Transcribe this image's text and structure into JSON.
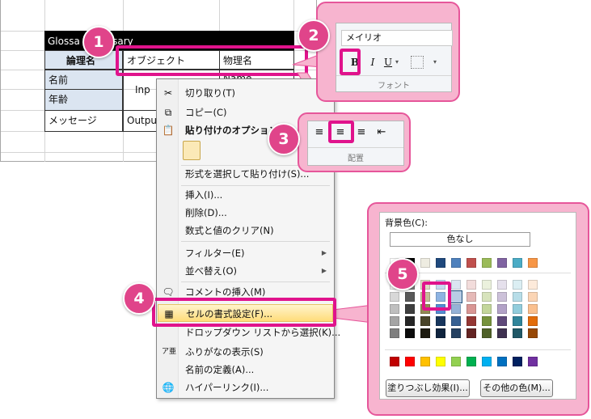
{
  "sheet": {
    "title_part1": "Glossa",
    "title_part2": "ssary",
    "col1_header": "論理名",
    "col2_header": "オブジェクト",
    "col3_header": "物理名",
    "row1": "名前",
    "row2": "年齢",
    "row3": "メッセージ",
    "inp": "Inp",
    "outp": "Outpu",
    "name_partial": "Name"
  },
  "badges": [
    "1",
    "2",
    "3",
    "4",
    "5"
  ],
  "font_panel": {
    "font_name": "メイリオ",
    "bold": "B",
    "italic": "I",
    "underline": "U",
    "group_label": "フォント"
  },
  "align_panel": {
    "group_label": "配置"
  },
  "menu": {
    "cut": "切り取り(T)",
    "copy": "コピー(C)",
    "paste_options": "貼り付けのオプション:",
    "paste_special": "形式を選択して貼り付け(S)...",
    "insert": "挿入(I)...",
    "delete": "削除(D)...",
    "clear": "数式と値のクリア(N)",
    "filter": "フィルター(E)",
    "sort": "並べ替え(O)",
    "comment": "コメントの挿入(M)",
    "format_cells": "セルの書式設定(F)...",
    "dropdown": "ドロップダウン リストから選択(K)...",
    "furigana": "ふりがなの表示(S)",
    "define_name": "名前の定義(A)...",
    "hyperlink": "ハイパーリンク(I)..."
  },
  "color_panel": {
    "label": "背景色(C):",
    "no_color": "色なし",
    "fill_effects": "塗りつぶし効果(I)...",
    "more_colors": "その他の色(M)...",
    "row1": [
      "#ffffff",
      "#000000",
      "#eeece1",
      "#1f497d",
      "#4f81bd",
      "#c0504d",
      "#9bbb59",
      "#8064a2",
      "#4bacc6",
      "#f79646"
    ],
    "shades": [
      [
        "#f2f2f2",
        "#7f7f7f",
        "#ddd9c3",
        "#c6d9f0",
        "#dbe5f1",
        "#f2dcdb",
        "#ebf1dd",
        "#e5e0ec",
        "#dbeef3",
        "#fdeada"
      ],
      [
        "#d8d8d8",
        "#595959",
        "#c4bd97",
        "#8db3e2",
        "#b8cce4",
        "#e5b9b7",
        "#d7e3bc",
        "#ccc1d9",
        "#b7dde8",
        "#fbd5b5"
      ],
      [
        "#bfbfbf",
        "#3f3f3f",
        "#938953",
        "#548dd4",
        "#95b3d7",
        "#d99694",
        "#c3d69b",
        "#b2a2c7",
        "#92cddc",
        "#fac08f"
      ],
      [
        "#a5a5a5",
        "#262626",
        "#494429",
        "#17365d",
        "#366092",
        "#953734",
        "#76923c",
        "#5f497a",
        "#31859b",
        "#e36c09"
      ],
      [
        "#7f7f7f",
        "#0c0c0c",
        "#1d1b10",
        "#0f243e",
        "#244061",
        "#632423",
        "#4f6128",
        "#3f3151",
        "#205867",
        "#974806"
      ]
    ],
    "standard": [
      "#c00000",
      "#ff0000",
      "#ffc000",
      "#ffff00",
      "#92d050",
      "#00b050",
      "#00b0f0",
      "#0070c0",
      "#002060",
      "#7030a0"
    ]
  },
  "colors": {
    "accent": "#e0138c",
    "panel": "#f7b4cf",
    "highlight": "#ffdc7a"
  }
}
